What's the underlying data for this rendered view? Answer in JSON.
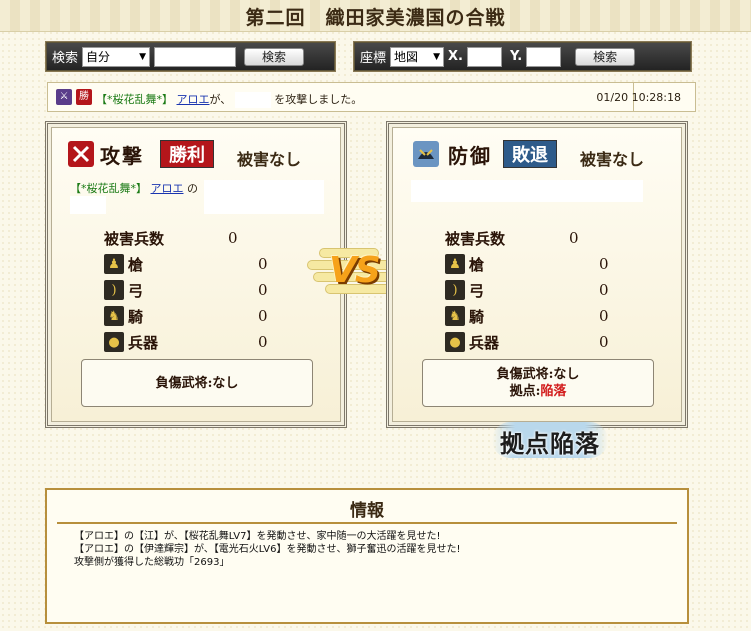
{
  "page": {
    "title": "第二回　織田家美濃国の合戦"
  },
  "search": {
    "label": "検索",
    "select_value": "自分",
    "input_value": "",
    "button": "検索"
  },
  "coords": {
    "label": "座標",
    "select_value": "地図",
    "x_label": "X.",
    "x_value": "",
    "y_label": "Y.",
    "y_value": "",
    "button": "検索"
  },
  "message": {
    "type_icon": "attack-icon",
    "result_icon_text": "勝",
    "alliance": "【*桜花乱舞*】",
    "player": "アロエ",
    "particle": "が、",
    "suffix": "を攻撃しました。",
    "time": "01/20 10:28:18"
  },
  "attacker": {
    "label": "攻撃",
    "result": "勝利",
    "damage_status": "被害なし",
    "alliance": "【*桜花乱舞*】",
    "player": "アロエ",
    "particle": "の",
    "casualties_label": "被害兵数",
    "casualties": "0",
    "units": [
      {
        "name": "槍",
        "icon": "spear-icon",
        "value": "0"
      },
      {
        "name": "弓",
        "icon": "bow-icon",
        "value": "0"
      },
      {
        "name": "騎",
        "icon": "horse-icon",
        "value": "0"
      },
      {
        "name": "兵器",
        "icon": "siege-weapon-icon",
        "value": "0"
      }
    ],
    "injured_text": "負傷武将:なし"
  },
  "defender": {
    "label": "防御",
    "result": "敗退",
    "damage_status": "被害なし",
    "casualties_label": "被害兵数",
    "casualties": "0",
    "units": [
      {
        "name": "槍",
        "icon": "spear-icon",
        "value": "0"
      },
      {
        "name": "弓",
        "icon": "bow-icon",
        "value": "0"
      },
      {
        "name": "騎",
        "icon": "horse-icon",
        "value": "0"
      },
      {
        "name": "兵器",
        "icon": "siege-weapon-icon",
        "value": "0"
      }
    ],
    "injured_text": "負傷武将:なし",
    "base_label": "拠点:",
    "base_status": "陥落"
  },
  "vs_text": "VS",
  "capture_text": "拠点陥落",
  "info": {
    "title": "情報",
    "lines": [
      "【アロエ】の【江】が、【桜花乱舞LV7】を発動させ、家中随一の大活躍を見せた!",
      "【アロエ】の【伊達輝宗】が、【電光石火LV6】を発動させ、獅子奮迅の活躍を見せた!",
      "攻撃側が獲得した総戦功「2693」"
    ]
  },
  "colors": {
    "win_badge": "#b4161b",
    "lose_badge": "#2e5b8a",
    "frame_gold": "#b78f3c",
    "link_green": "#1a7a14",
    "link_blue": "#1a35b0",
    "fall_red": "#d21a1a"
  }
}
